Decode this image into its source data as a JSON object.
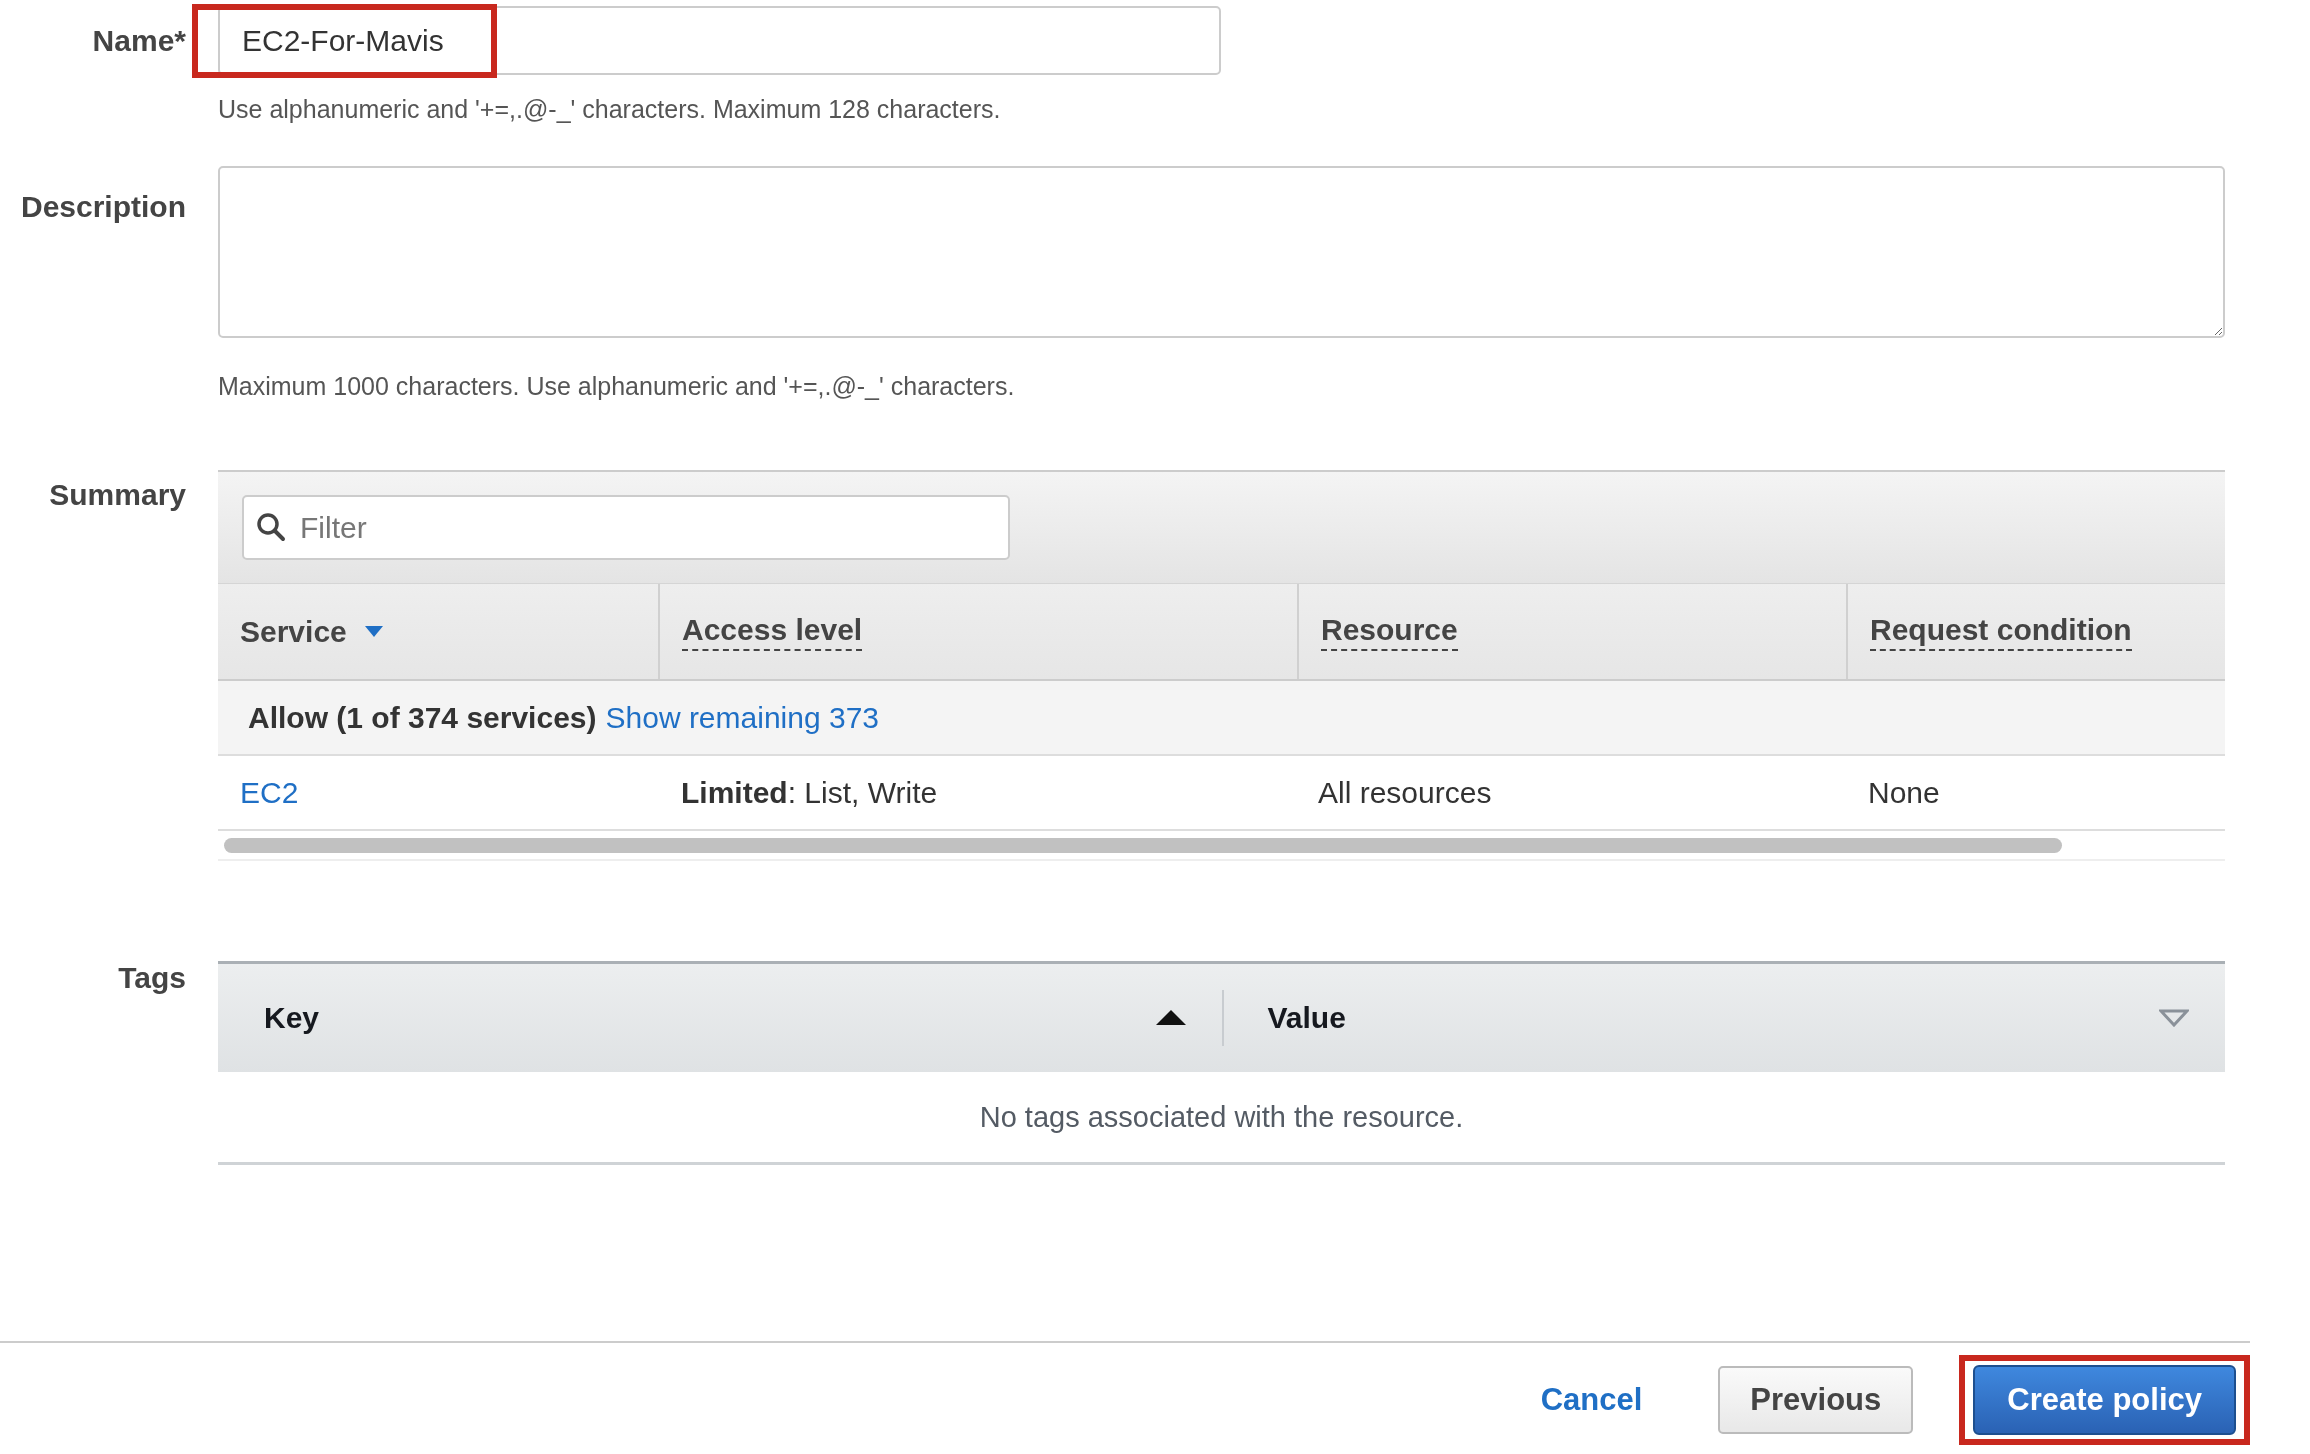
{
  "name_field": {
    "label": "Name*",
    "value": "EC2-For-Mavis",
    "highlighted": true,
    "hint": "Use alphanumeric and '+=,.@-_' characters. Maximum 128 characters."
  },
  "description_field": {
    "label": "Description",
    "hint": "Maximum 1000 characters. Use alphanumeric and '+=,.@-_' characters."
  },
  "summary": {
    "label": "Summary",
    "filter": {
      "placeholder": "Filter"
    },
    "columns": [
      {
        "label": "Service",
        "kind": "descending"
      },
      {
        "label": "Access level",
        "kind": "tooltip"
      },
      {
        "label": "Resource",
        "kind": "tooltip"
      },
      {
        "label": "Request condition",
        "kind": "tooltip"
      }
    ],
    "group": {
      "title": "Allow (1 of 374 services)",
      "link": "Show remaining 373"
    },
    "rows": [
      {
        "service": "EC2",
        "access_level": "**Limited**: List, Write",
        "resource": "All resources",
        "request_condition": "None"
      }
    ]
  },
  "tags": {
    "label": "Tags",
    "columns": [
      {
        "label": "Key",
        "kind": "ascending"
      },
      {
        "label": "Value",
        "kind": "sortable"
      }
    ],
    "empty_message": "No tags associated with the resource."
  },
  "buttons": [
    {
      "label": "Cancel",
      "kind": "link",
      "highlighted": false
    },
    {
      "label": "Previous",
      "kind": "secondary",
      "highlighted": false
    },
    {
      "label": "Create policy",
      "kind": "primary",
      "highlighted": true
    }
  ]
}
